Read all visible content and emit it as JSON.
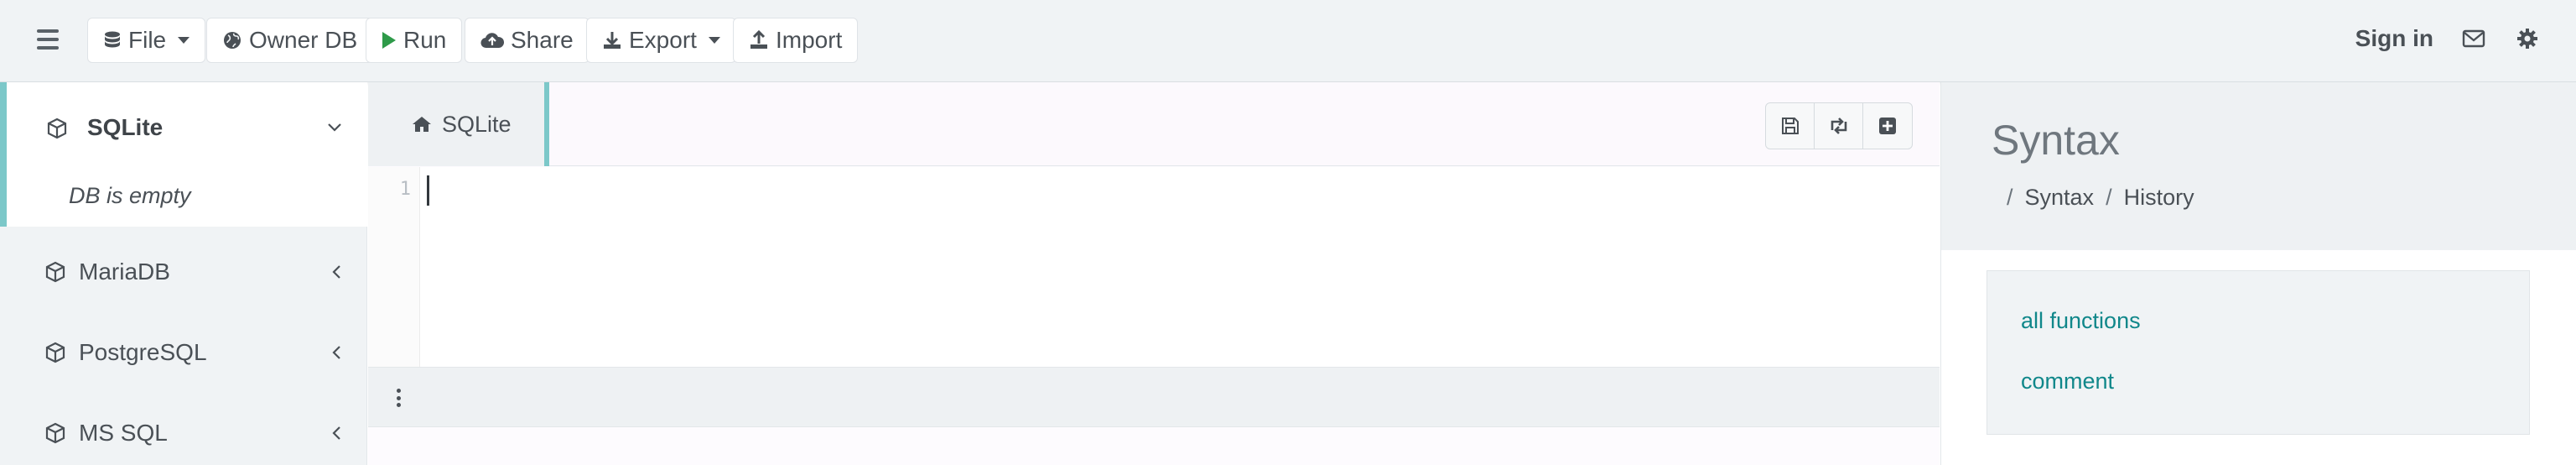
{
  "navbar": {
    "file_label": "File",
    "owner_db_label": "Owner DB",
    "run_label": "Run",
    "share_label": "Share",
    "export_label": "Export",
    "import_label": "Import",
    "signin_label": "Sign in"
  },
  "sidebar": {
    "items": [
      {
        "label": "SQLite",
        "expanded": true,
        "status": "DB is empty"
      },
      {
        "label": "MariaDB",
        "expanded": false
      },
      {
        "label": "PostgreSQL",
        "expanded": false
      },
      {
        "label": "MS SQL",
        "expanded": false
      }
    ]
  },
  "editor": {
    "tab_label": "SQLite",
    "line_numbers": [
      "1"
    ],
    "content": ""
  },
  "right_panel": {
    "title": "Syntax",
    "breadcrumb": [
      "Syntax",
      "History"
    ],
    "links": [
      "all functions",
      "comment"
    ]
  },
  "colors": {
    "accent": "#7cc8c9",
    "link": "#10878a",
    "run_icon": "#2e9a49",
    "navbar_bg": "#f0f3f5"
  }
}
